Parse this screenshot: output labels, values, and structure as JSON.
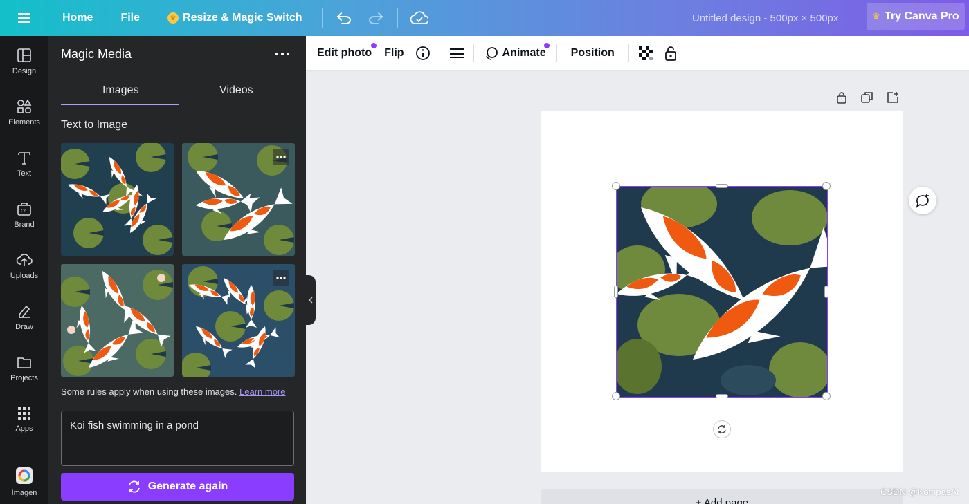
{
  "topbar": {
    "home": "Home",
    "file": "File",
    "resize": "Resize & Magic Switch",
    "title": "Untitled design - 500px × 500px",
    "pro": "Try Canva Pro"
  },
  "rail": [
    {
      "label": "Design",
      "icon": "design-icon"
    },
    {
      "label": "Elements",
      "icon": "elements-icon"
    },
    {
      "label": "Text",
      "icon": "text-icon"
    },
    {
      "label": "Brand",
      "icon": "brand-icon"
    },
    {
      "label": "Uploads",
      "icon": "uploads-icon"
    },
    {
      "label": "Draw",
      "icon": "draw-icon"
    },
    {
      "label": "Projects",
      "icon": "projects-icon"
    },
    {
      "label": "Apps",
      "icon": "apps-icon"
    },
    {
      "label": "Imagen",
      "icon": "imagen-icon"
    }
  ],
  "panel": {
    "title": "Magic Media",
    "tabs": [
      "Images",
      "Videos"
    ],
    "section": "Text to Image",
    "rules_text": "Some rules apply when using these images.",
    "learn_more": "Learn more",
    "prompt": "Koi fish swimming in a pond",
    "generate": "Generate again"
  },
  "context": {
    "edit_photo": "Edit photo",
    "flip": "Flip",
    "animate": "Animate",
    "position": "Position"
  },
  "canvas": {
    "add_page": "+ Add page"
  },
  "watermark": "CSDN @KompasAI",
  "colors": {
    "accent": "#8b3dff",
    "panel": "#252627",
    "rail": "#18191b"
  }
}
